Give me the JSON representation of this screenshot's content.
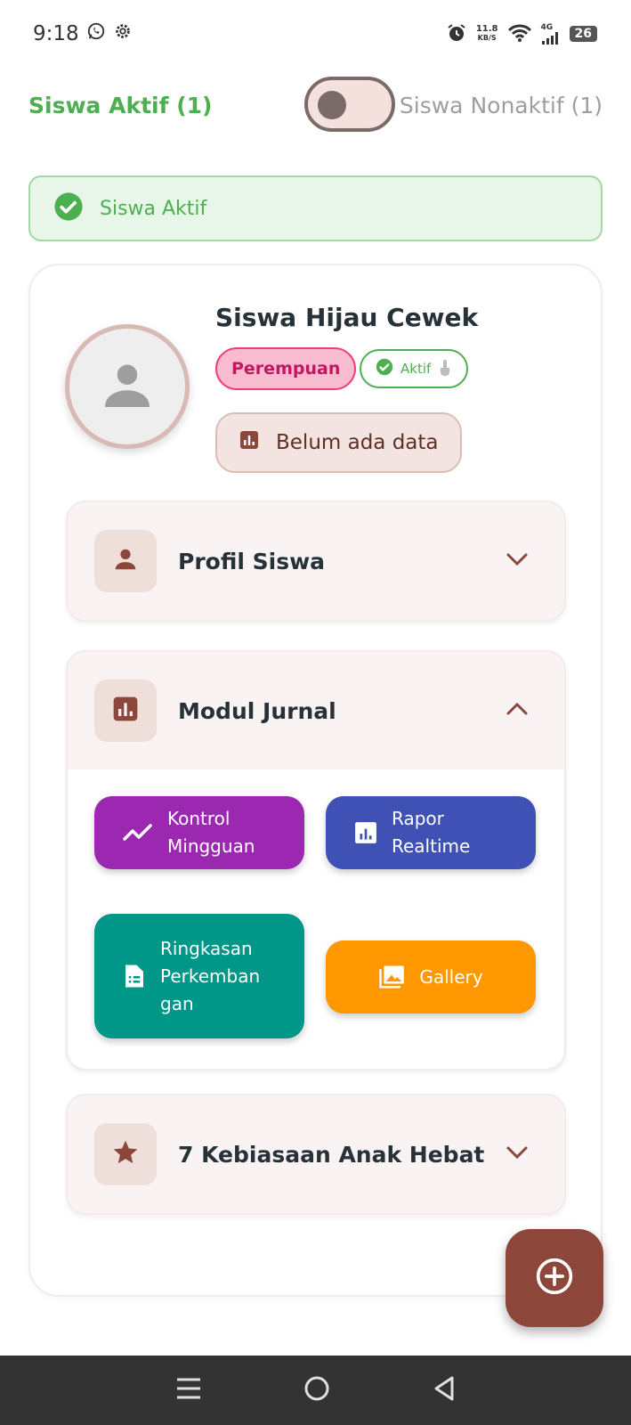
{
  "status_bar": {
    "time": "9:18",
    "speed_value": "11.8",
    "speed_unit": "KB/S",
    "network": "4G",
    "battery": "26"
  },
  "toggle": {
    "active_label": "Siswa Aktif (1)",
    "inactive_label": "Siswa Nonaktif (1)",
    "on": false
  },
  "banner": {
    "text": "Siswa Aktif"
  },
  "student": {
    "name": "Siswa Hijau Cewek",
    "gender": "Perempuan",
    "status": "Aktif",
    "data_label": "Belum ada data"
  },
  "sections": {
    "profile": {
      "title": "Profil Siswa"
    },
    "journal": {
      "title": "Modul Jurnal",
      "tiles": [
        {
          "label": "Kontrol Mingguan",
          "color": "#9c27b0"
        },
        {
          "label": "Rapor Realtime",
          "color": "#3f51b5"
        },
        {
          "label": "Ringkasan Perkembangan",
          "color": "#009688"
        },
        {
          "label": "Gallery",
          "color": "#ff9800"
        }
      ]
    },
    "habits": {
      "title": "7 Kebiasaan Anak Hebat"
    }
  },
  "colors": {
    "primary": "#8d463a",
    "success": "#4caf50",
    "pink": "#ec407a"
  }
}
